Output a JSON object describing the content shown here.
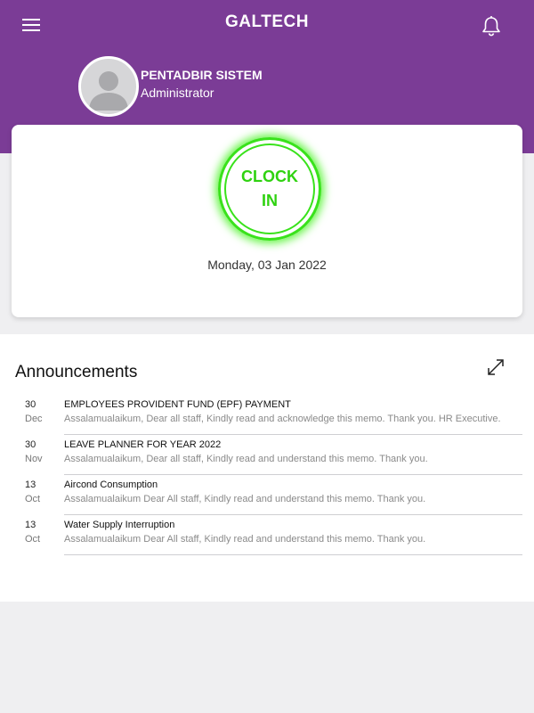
{
  "header": {
    "brand": "GALTECH",
    "menu_icon": "hamburger-menu-icon",
    "bell_icon": "bell-icon",
    "background": "#7b3c96"
  },
  "user": {
    "name": "PENTADBIR SISTEM",
    "role": "Administrator",
    "avatar_icon": "user-avatar-icon"
  },
  "clock": {
    "label_line1": "CLOCK",
    "label_line2": "IN",
    "date": "Monday, 03 Jan 2022",
    "accent": "#2fd211"
  },
  "announcements": {
    "title": "Announcements",
    "expand_icon": "expand-icon",
    "items": [
      {
        "day": "30",
        "month": "Dec",
        "title": "EMPLOYEES PROVIDENT FUND (EPF) PAYMENT",
        "summary": "Assalamualaikum, Dear all staff, Kindly read and acknowledge this memo. Thank you. HR Executive."
      },
      {
        "day": "30",
        "month": "Nov",
        "title": "LEAVE PLANNER FOR YEAR 2022",
        "summary": "Assalamualaikum, Dear all staff, Kindly read and understand this memo. Thank you."
      },
      {
        "day": "13",
        "month": "Oct",
        "title": "Aircond Consumption",
        "summary": "Assalamualaikum Dear All staff, Kindly read and understand this memo. Thank you."
      },
      {
        "day": "13",
        "month": "Oct",
        "title": "Water Supply Interruption",
        "summary": "Assalamualaikum Dear All staff, Kindly read and understand this memo. Thank you."
      }
    ]
  }
}
